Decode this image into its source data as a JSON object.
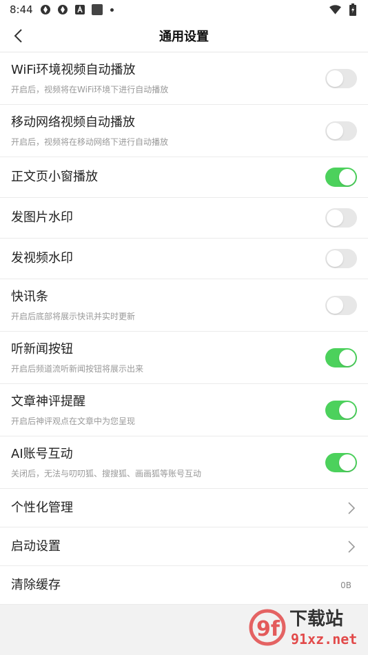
{
  "status_bar": {
    "time": "8:44",
    "icons": [
      "vpn-icon",
      "vpn-icon-2",
      "a-icon",
      "square-icon",
      "dot-icon",
      "wifi-icon",
      "battery-icon"
    ]
  },
  "header": {
    "title": "通用设置",
    "back_icon": "chevron-left-icon"
  },
  "settings": [
    {
      "label": "WiFi环境视频自动播放",
      "sub": "开启后，视频将在WiFi环境下进行自动播放",
      "on": false
    },
    {
      "label": "移动网络视频自动播放",
      "sub": "开启后，视频将在移动网络下进行自动播放",
      "on": false
    },
    {
      "label": "正文页小窗播放",
      "sub": "",
      "on": true
    },
    {
      "label": "发图片水印",
      "sub": "",
      "on": false
    },
    {
      "label": "发视频水印",
      "sub": "",
      "on": false
    },
    {
      "label": "快讯条",
      "sub": "开启后底部将展示快讯并实时更新",
      "on": false
    },
    {
      "label": "听新闻按钮",
      "sub": "开启后频道流听新闻按钮将展示出来",
      "on": true
    },
    {
      "label": "文章神评提醒",
      "sub": "开启后神评观点在文章中为您呈现",
      "on": true
    },
    {
      "label": "AI账号互动",
      "sub": "关闭后，无法与叨叨狐、搜搜狐、画画狐等账号互动",
      "on": true
    }
  ],
  "nav_items": [
    {
      "label": "个性化管理",
      "icon": "chevron-right-icon"
    },
    {
      "label": "启动设置",
      "icon": "chevron-right-icon"
    }
  ],
  "cache": {
    "label": "清除缓存",
    "value": "0B"
  },
  "colors": {
    "toggle_on": "#4cd15c",
    "toggle_off": "#e7e7e7"
  },
  "watermark": {
    "logo_text": "9f",
    "title": "下载站",
    "url": "91xz.net"
  }
}
